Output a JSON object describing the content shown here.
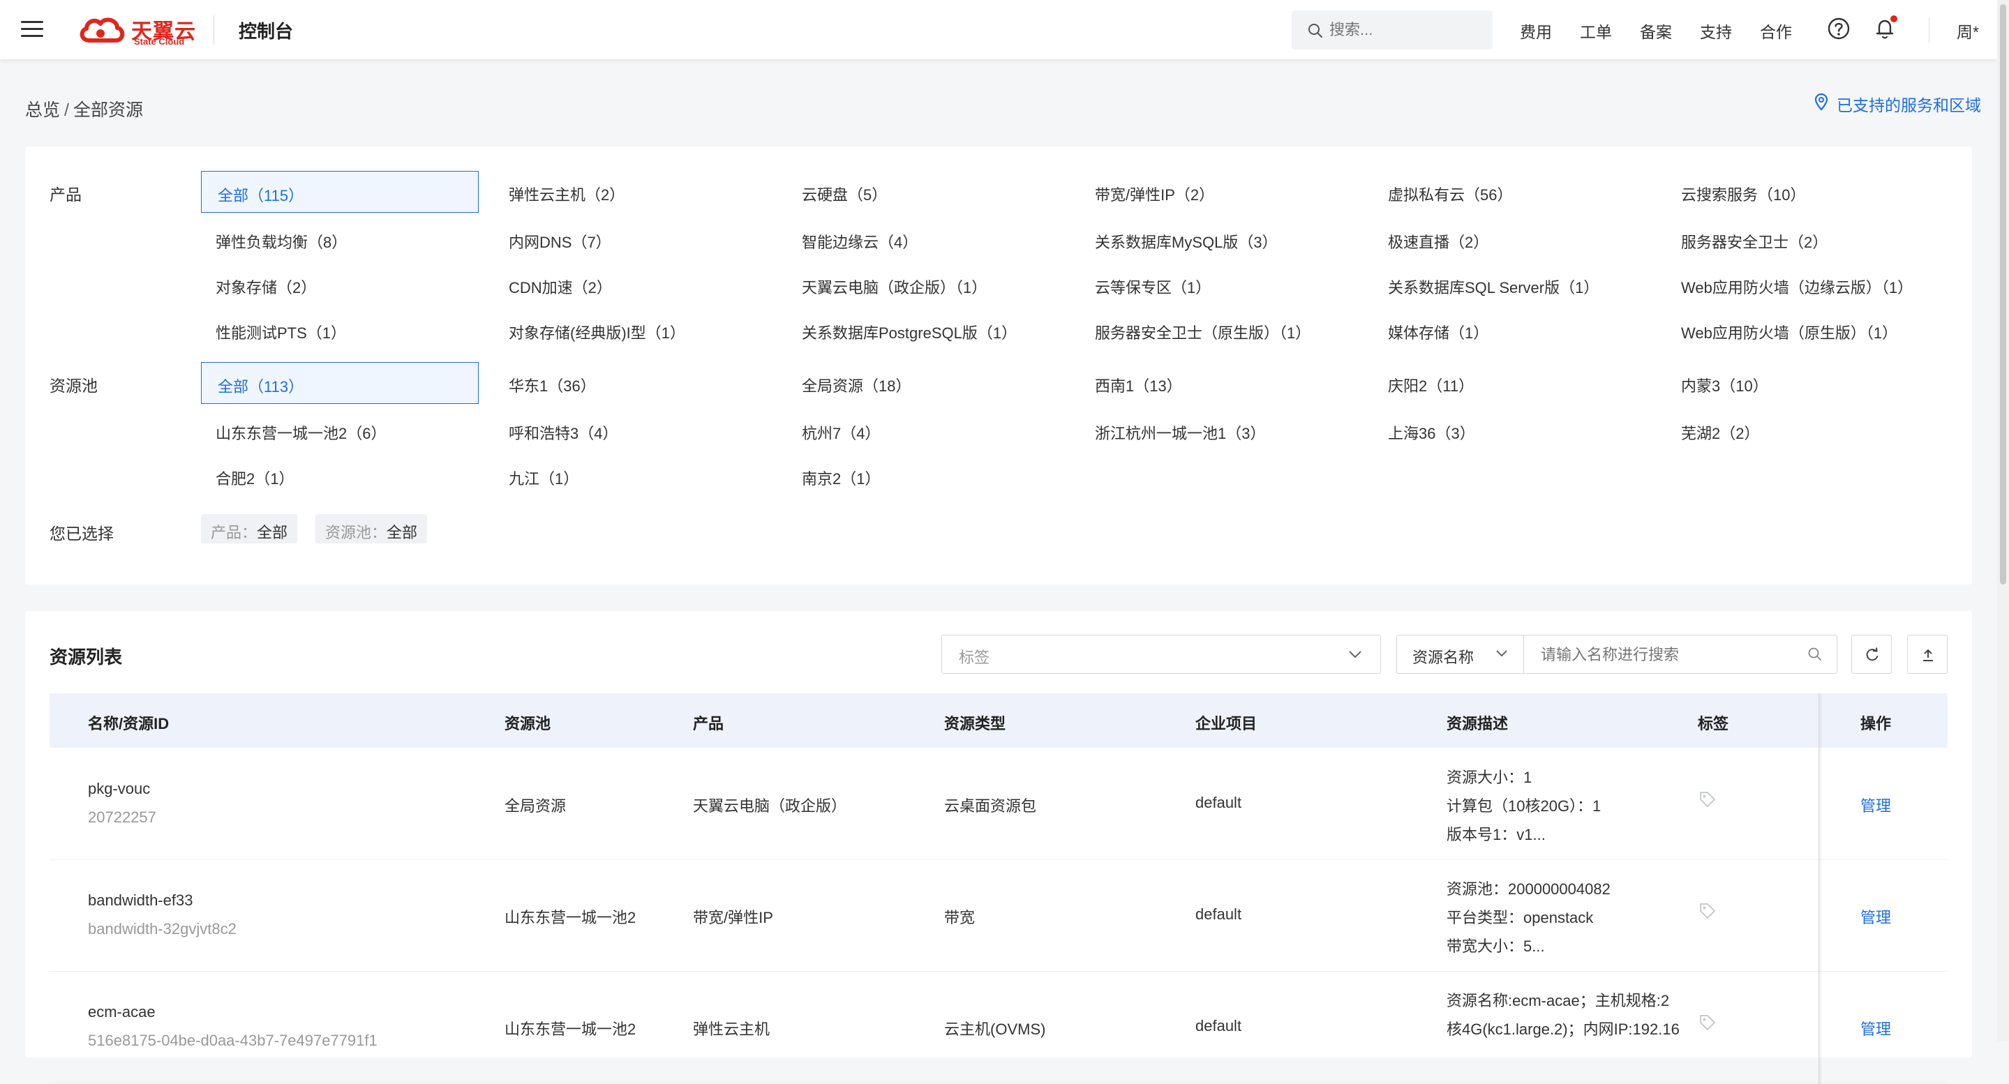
{
  "header": {
    "logo_cn": "天翼云",
    "logo_en": "State Cloud",
    "console_title": "控制台",
    "search_placeholder": "搜索...",
    "nav": [
      "费用",
      "工单",
      "备案",
      "支持",
      "合作"
    ],
    "user": "周*"
  },
  "breadcrumb": {
    "root": "总览",
    "separator": "/",
    "current": "全部资源"
  },
  "region_link": "已支持的服务和区域",
  "filters": {
    "product_label": "产品",
    "products": [
      "全部（115）",
      "弹性云主机（2）",
      "云硬盘（5）",
      "带宽/弹性IP（2）",
      "虚拟私有云（56）",
      "云搜索服务（10）",
      "弹性负载均衡（8）",
      "内网DNS（7）",
      "智能边缘云（4）",
      "关系数据库MySQL版（3）",
      "极速直播（2）",
      "服务器安全卫士（2）",
      "对象存储（2）",
      "CDN加速（2）",
      "天翼云电脑（政企版）（1）",
      "云等保专区（1）",
      "关系数据库SQL Server版（1）",
      "Web应用防火墙（边缘云版）（1）",
      "性能测试PTS（1）",
      "对象存储(经典版)I型（1）",
      "关系数据库PostgreSQL版（1）",
      "服务器安全卫士（原生版）（1）",
      "媒体存储（1）",
      "Web应用防火墙（原生版）（1）"
    ],
    "pool_label": "资源池",
    "pools": [
      "全部（113）",
      "华东1（36）",
      "全局资源（18）",
      "西南1（13）",
      "庆阳2（11）",
      "内蒙3（10）",
      "山东东营一城一池2（6）",
      "呼和浩特3（4）",
      "杭州7（4）",
      "浙江杭州一城一池1（3）",
      "上海36（3）",
      "芜湖2（2）",
      "合肥2（1）",
      "九江（1）",
      "南京2（1）"
    ],
    "selected_label": "您已选择",
    "chips": [
      {
        "key": "产品：",
        "value": "全部"
      },
      {
        "key": "资源池：",
        "value": "全部"
      }
    ]
  },
  "list": {
    "title": "资源列表",
    "tag_placeholder": "标签",
    "name_select": "资源名称",
    "name_placeholder": "请输入名称进行搜索",
    "columns": [
      "名称/资源ID",
      "资源池",
      "产品",
      "资源类型",
      "企业项目",
      "资源描述",
      "标签",
      "操作"
    ],
    "rows": [
      {
        "name": "pkg-vouc",
        "id": "20722257",
        "pool": "全局资源",
        "product": "天翼云电脑（政企版）",
        "type": "云桌面资源包",
        "project": "default",
        "desc": [
          "资源大小：1",
          "计算包（10核20G）：1",
          "版本号1：v1..."
        ],
        "action": "管理"
      },
      {
        "name": "bandwidth-ef33",
        "id": "bandwidth-32gvjvt8c2",
        "pool": "山东东营一城一池2",
        "product": "带宽/弹性IP",
        "type": "带宽",
        "project": "default",
        "desc": [
          "资源池：200000004082",
          "平台类型：openstack",
          "带宽大小：5..."
        ],
        "action": "管理"
      },
      {
        "name": "ecm-acae",
        "id": "516e8175-04be-d0aa-43b7-7e497e7791f1",
        "pool": "山东东营一城一池2",
        "product": "弹性云主机",
        "type": "云主机(OVMS)",
        "project": "default",
        "desc": [
          "资源名称:ecm-acae；主机规格:2",
          "核4G(kc1.large.2)；内网IP:192.16"
        ],
        "action": "管理"
      }
    ]
  }
}
